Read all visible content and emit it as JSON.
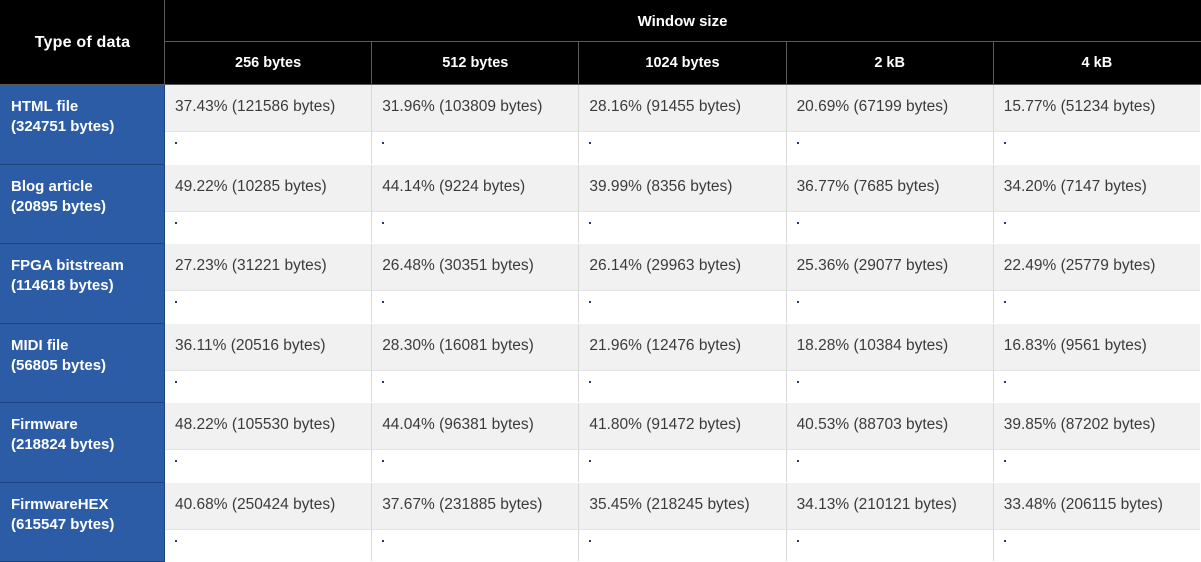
{
  "header": {
    "corner_label": "Type of data",
    "group_label": "Window size",
    "columns": [
      "256 bytes",
      "512 bytes",
      "1024 bytes",
      "2 kB",
      "4 kB"
    ]
  },
  "colors": {
    "header_bg": "#000000",
    "rowlabel_bg": "#2c5ca5",
    "bar_fill": "#2c5ca5",
    "bar_track": "#cfe1f0",
    "value_bg": "#f1f1f1"
  },
  "chart_data": {
    "type": "table",
    "title": "Compression ratio by window size",
    "xlabel": "Window size",
    "ylabel": "Type of data",
    "categories": [
      "256 bytes",
      "512 bytes",
      "1024 bytes",
      "2 kB",
      "4 kB"
    ],
    "bar_scale_max": 50,
    "rows": [
      {
        "name": "HTML file",
        "size": "(324751 bytes)",
        "cells": [
          {
            "text": "37.43% (121586 bytes)",
            "percent": 37.43,
            "bytes": 121586
          },
          {
            "text": "31.96% (103809 bytes)",
            "percent": 31.96,
            "bytes": 103809
          },
          {
            "text": "28.16% (91455 bytes)",
            "percent": 28.16,
            "bytes": 91455
          },
          {
            "text": "20.69% (67199 bytes)",
            "percent": 20.69,
            "bytes": 67199
          },
          {
            "text": "15.77% (51234 bytes)",
            "percent": 15.77,
            "bytes": 51234
          }
        ]
      },
      {
        "name": "Blog article",
        "size": "(20895 bytes)",
        "cells": [
          {
            "text": "49.22% (10285 bytes)",
            "percent": 49.22,
            "bytes": 10285
          },
          {
            "text": "44.14% (9224 bytes)",
            "percent": 44.14,
            "bytes": 9224
          },
          {
            "text": "39.99% (8356 bytes)",
            "percent": 39.99,
            "bytes": 8356
          },
          {
            "text": "36.77% (7685 bytes)",
            "percent": 36.77,
            "bytes": 7685
          },
          {
            "text": "34.20% (7147 bytes)",
            "percent": 34.2,
            "bytes": 7147
          }
        ]
      },
      {
        "name": "FPGA bitstream",
        "size": "(114618 bytes)",
        "cells": [
          {
            "text": "27.23% (31221 bytes)",
            "percent": 27.23,
            "bytes": 31221
          },
          {
            "text": "26.48% (30351 bytes)",
            "percent": 26.48,
            "bytes": 30351
          },
          {
            "text": "26.14% (29963 bytes)",
            "percent": 26.14,
            "bytes": 29963
          },
          {
            "text": "25.36% (29077 bytes)",
            "percent": 25.36,
            "bytes": 29077
          },
          {
            "text": "22.49% (25779 bytes)",
            "percent": 22.49,
            "bytes": 25779
          }
        ]
      },
      {
        "name": "MIDI file",
        "size": "(56805 bytes)",
        "cells": [
          {
            "text": "36.11% (20516 bytes)",
            "percent": 36.11,
            "bytes": 20516
          },
          {
            "text": "28.30% (16081 bytes)",
            "percent": 28.3,
            "bytes": 16081
          },
          {
            "text": "21.96% (12476 bytes)",
            "percent": 21.96,
            "bytes": 12476
          },
          {
            "text": "18.28% (10384 bytes)",
            "percent": 18.28,
            "bytes": 10384
          },
          {
            "text": "16.83% (9561 bytes)",
            "percent": 16.83,
            "bytes": 9561
          }
        ]
      },
      {
        "name": "Firmware",
        "size": "(218824 bytes)",
        "cells": [
          {
            "text": "48.22% (105530 bytes)",
            "percent": 48.22,
            "bytes": 105530
          },
          {
            "text": "44.04% (96381 bytes)",
            "percent": 44.04,
            "bytes": 96381
          },
          {
            "text": "41.80% (91472 bytes)",
            "percent": 41.8,
            "bytes": 91472
          },
          {
            "text": "40.53% (88703 bytes)",
            "percent": 40.53,
            "bytes": 88703
          },
          {
            "text": "39.85% (87202 bytes)",
            "percent": 39.85,
            "bytes": 87202
          }
        ]
      },
      {
        "name": "FirmwareHEX",
        "size": "(615547 bytes)",
        "cells": [
          {
            "text": "40.68% (250424 bytes)",
            "percent": 40.68,
            "bytes": 250424
          },
          {
            "text": "37.67% (231885 bytes)",
            "percent": 37.67,
            "bytes": 231885
          },
          {
            "text": "35.45% (218245 bytes)",
            "percent": 35.45,
            "bytes": 218245
          },
          {
            "text": "34.13% (210121 bytes)",
            "percent": 34.13,
            "bytes": 210121
          },
          {
            "text": "33.48% (206115 bytes)",
            "percent": 33.48,
            "bytes": 206115
          }
        ]
      }
    ]
  }
}
